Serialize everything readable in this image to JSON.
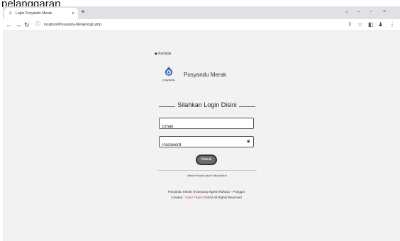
{
  "caption": "pelanggaran",
  "browser": {
    "tab_title": "Login Posyandu Merak",
    "tab_close": "×",
    "new_tab": "+",
    "url": "localhost/Posyandu-Merak/login.php",
    "win_controls": [
      "⌄",
      "–",
      "▫",
      "×"
    ]
  },
  "page": {
    "back_label": "Kembali",
    "brand_name": "Posyandu Merak",
    "logo_text": "posyandu",
    "heading": "Silahkan Login Disini",
    "email_placeholder": "Email",
    "password_placeholder": "Password",
    "login_button": "Masuk",
    "register_text": "Belum Punya Akun? Buat Akun",
    "footer_line1": "Posyandu Merak | Kampung Ngesti Rahayu - Punggur",
    "footer_created": "Created :",
    "footer_author": "Catur Trianti",
    "footer_rights": "©2023 All Rights Reserved"
  },
  "colors": {
    "logo_blue": "#3b6fb0",
    "author_red": "#c0392b"
  }
}
